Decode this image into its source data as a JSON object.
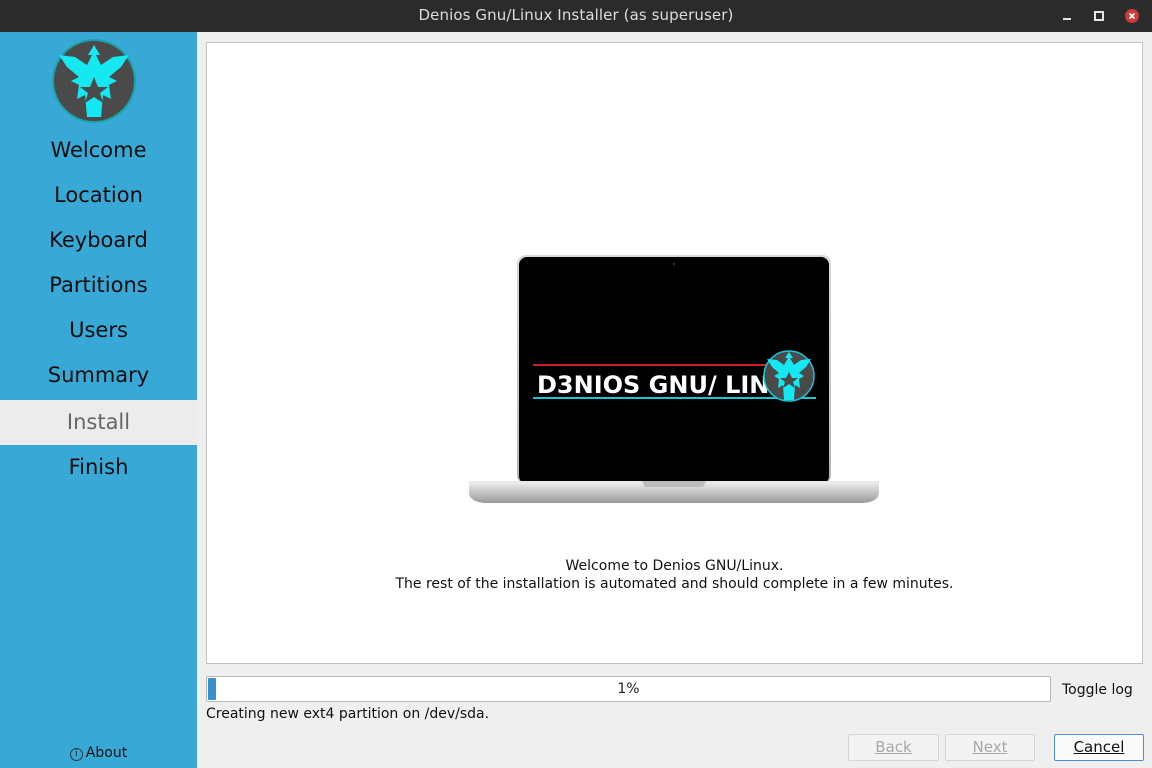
{
  "window": {
    "title": "Denios Gnu/Linux Installer (as superuser)"
  },
  "sidebar": {
    "items": [
      {
        "label": "Welcome"
      },
      {
        "label": "Location"
      },
      {
        "label": "Keyboard"
      },
      {
        "label": "Partitions"
      },
      {
        "label": "Users"
      },
      {
        "label": "Summary"
      },
      {
        "label": "Install",
        "active": true
      },
      {
        "label": "Finish"
      }
    ],
    "about_label": "About"
  },
  "main": {
    "slide_logo_text": "D3NIOS GNU/ LINUX",
    "welcome_line1": "Welcome to Denios GNU/Linux.",
    "welcome_line2": "The rest of the installation is automated and should complete in a few minutes."
  },
  "progress": {
    "value": 0.01,
    "label": "1%",
    "toggle_log": "Toggle log",
    "status": "Creating new ext4 partition on /dev/sda."
  },
  "buttons": {
    "back": "Back",
    "next": "Next",
    "cancel": "Cancel"
  },
  "colors": {
    "sidebar": "#38a9d6",
    "accent": "#3a8fd1",
    "logo_cyan": "#15e8f0",
    "logo_red": "#d22020"
  }
}
